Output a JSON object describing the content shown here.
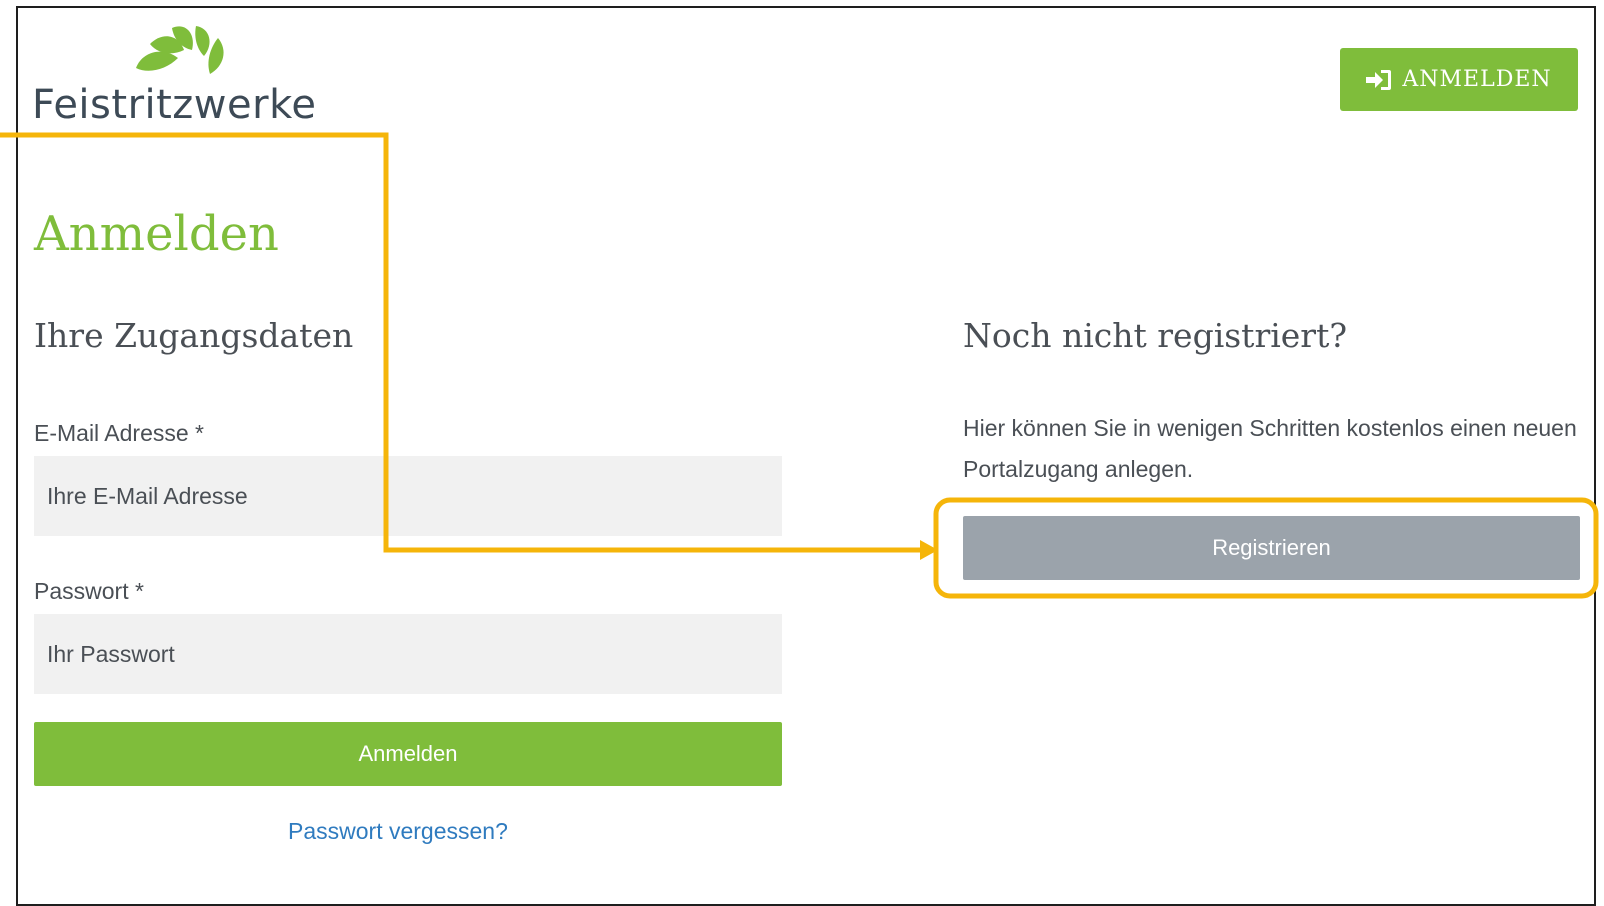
{
  "brand": {
    "name": "Feistritzwerke",
    "logo_icon": "leaf-fan-icon",
    "accent": "#7fbd3b"
  },
  "header": {
    "login_button": "ANMELDEN",
    "login_icon": "sign-in-icon"
  },
  "page": {
    "title": "Anmelden"
  },
  "login": {
    "heading": "Ihre Zugangsdaten",
    "email_label": "E-Mail Adresse *",
    "email_placeholder": "Ihre E-Mail Adresse",
    "password_label": "Passwort *",
    "password_placeholder": "Ihr Passwort",
    "submit": "Anmelden",
    "forgot": "Passwort vergessen?"
  },
  "register": {
    "heading": "Noch nicht registriert?",
    "text": "Hier können Sie in wenigen Schritten kostenlos einen neuen Portalzugang anlegen.",
    "button": "Registrieren"
  },
  "annotation": {
    "color": "#f5b50a",
    "target": "register-button"
  }
}
